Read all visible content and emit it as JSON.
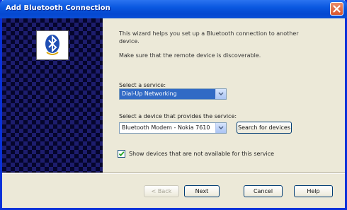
{
  "window": {
    "title": "Add Bluetooth Connection"
  },
  "description": "This wizard helps you set up a Bluetooth connection to another device.",
  "hint": "Make sure that the remote device is discoverable.",
  "select_service": {
    "label": "Select a service:",
    "value": "Dial-Up Networking"
  },
  "select_device": {
    "label": "Select a device that provides the service:",
    "value": "Bluetooth Modem - Nokia 7610",
    "search_button": "Search for devices"
  },
  "checkbox": {
    "label": "Show devices that are not available for this service",
    "checked": true
  },
  "buttons": {
    "back": "< Back",
    "next": "Next",
    "cancel": "Cancel",
    "help": "Help"
  },
  "icons": [
    "bluetooth-icon",
    "close-icon",
    "dropdown-arrow-icon",
    "checkmark-icon"
  ],
  "colors": {
    "titlebar": "#0a58e0",
    "selection": "#316ac5",
    "panel": "#1d1d6e"
  }
}
